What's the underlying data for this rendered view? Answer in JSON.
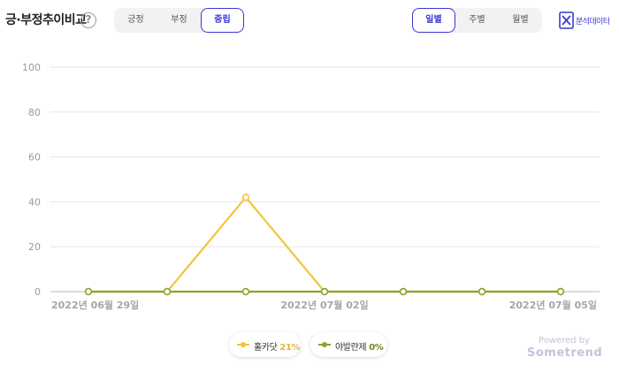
{
  "header": {
    "title": "긍·부정추이비교",
    "help_symbol": "?",
    "sentiment_tabs": [
      {
        "label": "긍정",
        "active": false
      },
      {
        "label": "부정",
        "active": false
      },
      {
        "label": "중립",
        "active": true
      }
    ],
    "period_tabs": [
      {
        "label": "일별",
        "active": true
      },
      {
        "label": "주별",
        "active": false
      },
      {
        "label": "월별",
        "active": false
      }
    ],
    "export_label": "분석데이터"
  },
  "legend": {
    "items": [
      {
        "name": "홀카닷",
        "value": "21%"
      },
      {
        "name": "야발란제",
        "value": "0%"
      }
    ]
  },
  "footer": {
    "powered_by": "Powered by",
    "brand": "Sometrend"
  },
  "colors": {
    "accent": "#3d37d4",
    "series_1": "#f2c43d",
    "series_2": "#8aa32a",
    "grid": "#e6e6e6",
    "baseline": "#b8b8b8"
  },
  "chart_data": {
    "type": "line",
    "x": [
      "2022-06-29",
      "2022-06-30",
      "2022-07-01",
      "2022-07-02",
      "2022-07-03",
      "2022-07-04",
      "2022-07-05"
    ],
    "x_tick_labels": [
      {
        "index": 0,
        "label": "2022년 06월 29일"
      },
      {
        "index": 3,
        "label": "2022년 07월 02일"
      },
      {
        "index": 6,
        "label": "2022년 07월 05일"
      }
    ],
    "series": [
      {
        "name": "홀카닷",
        "values": [
          0,
          0,
          42,
          0,
          0,
          0,
          0
        ]
      },
      {
        "name": "야발란제",
        "values": [
          0,
          0,
          0,
          0,
          0,
          0,
          0
        ]
      }
    ],
    "ylim": [
      0,
      100
    ],
    "yticks": [
      0,
      20,
      40,
      60,
      80,
      100
    ],
    "grid": true,
    "legend_position": "bottom-center"
  }
}
